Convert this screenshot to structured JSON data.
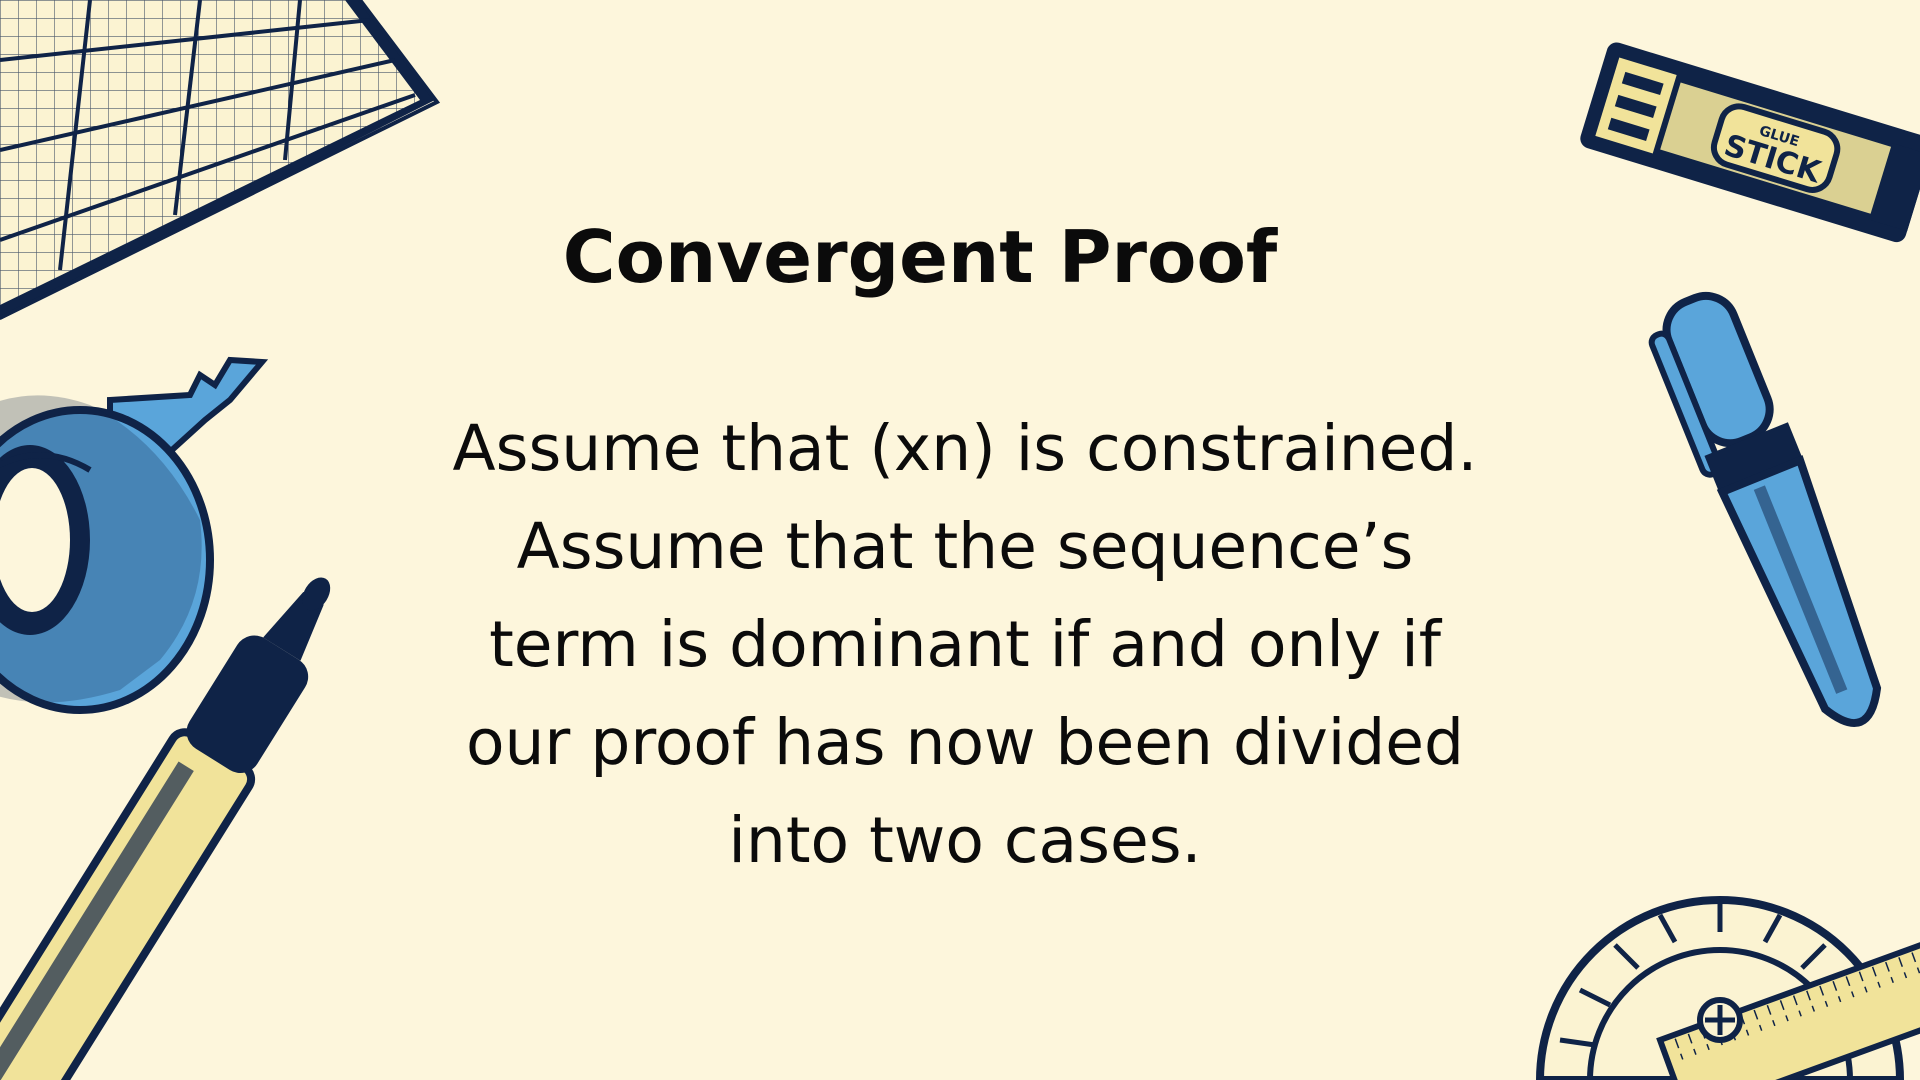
{
  "slide": {
    "title": "Convergent Proof",
    "body_lines": [
      "Assume that (xn) is constrained.",
      "Assume that the sequence’s",
      "term is dominant if and only if",
      "our proof has now been divided",
      "into two cases."
    ]
  },
  "decorations": {
    "glue_stick": {
      "top_text": "GLUE",
      "main_text": "STICK"
    },
    "icons": [
      "cutting-mat-icon",
      "tape-roll-icon",
      "marker-icon",
      "glue-stick-icon",
      "pen-icon",
      "protractor-icon"
    ]
  },
  "colors": {
    "background": "#fdf6dc",
    "navy": "#0f2347",
    "blue": "#5aa5da",
    "pale_yellow": "#f1e39a",
    "text": "#0b0b0b"
  }
}
